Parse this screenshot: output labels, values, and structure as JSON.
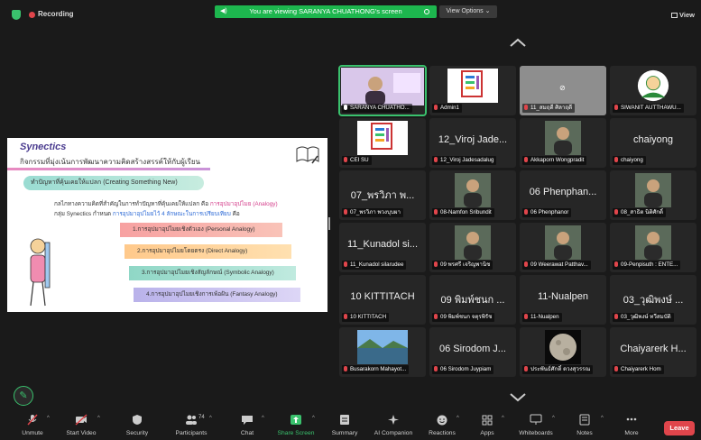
{
  "topbar": {
    "recording_label": "Recording",
    "banner_text": "You are viewing SARANYA CHUATHONG's screen",
    "view_options_label": "View Options",
    "view_label": "View"
  },
  "slide": {
    "title": "Synectics",
    "subtitle": "กิจกรรมที่มุ่งเน้นการพัฒนาความคิดสร้างสรรค์ให้กับผู้เรียน",
    "pill": "ทำปัญหาที่คุ้นเคยให้แปลก (Creating Something New)",
    "line1_a": "กลไกทางความคิดที่สำคัญในการทำปัญหาที่คุ้นเคยให้แปลก คือ",
    "line1_b": "การอุปมาอุปไมย (Analogy)",
    "line2_a": "กลุ่ม Synectics กำหนด",
    "line2_b": "การอุปมาอุปไมยไว้ 4 ลักษณะในการเปรียบเทียบ",
    "line2_c": "คือ",
    "ribbons": [
      "1.การอุปมาอุปไมยเชิงตัวเอง (Personal Analogy)",
      "2.การอุปมาอุปไมยโดยตรง (Direct Analogy)",
      "3.การอุปมาอุปไมยเชิงสัญลักษณ์ (Symbolic Analogy)",
      "4.การอุปมาอุปไมยเชิงการเพ้อฝัน (Fantasy Analogy)"
    ]
  },
  "gallery": {
    "tiles": [
      {
        "label": "SARANYA CHUATHO...",
        "big": "",
        "kind": "photo",
        "muted": false
      },
      {
        "label": "Admin1",
        "big": "",
        "kind": "logo",
        "muted": true
      },
      {
        "label": "11_สมฤดี ศิลาฤดี",
        "big": "",
        "kind": "gray",
        "muted": true
      },
      {
        "label": "SIWANIT AUTTHAWU...",
        "big": "",
        "kind": "cartoon",
        "muted": true
      },
      {
        "label": "CEI SU",
        "big": "",
        "kind": "logo",
        "muted": true
      },
      {
        "label": "12_Viroj Jadesadalug",
        "big": "12_Viroj Jade...",
        "kind": "name",
        "muted": true
      },
      {
        "label": "Akkaporn Wongpradit",
        "big": "",
        "kind": "photo",
        "muted": true
      },
      {
        "label": "chaiyong",
        "big": "chaiyong",
        "kind": "name",
        "muted": true
      },
      {
        "label": "07_พรวิภา พวงบุบผา",
        "big": "07_พรวิภา พ...",
        "kind": "name",
        "muted": true
      },
      {
        "label": "08-Namfon Sribundit",
        "big": "",
        "kind": "photo",
        "muted": true
      },
      {
        "label": "06 Phenphanor",
        "big": "06 Phenphan...",
        "kind": "name",
        "muted": true
      },
      {
        "label": "08_สาธิต นิติศักดิ์",
        "big": "",
        "kind": "photo",
        "muted": true
      },
      {
        "label": "11_Kunadol silarudee",
        "big": "11_Kunadol si...",
        "kind": "name",
        "muted": true
      },
      {
        "label": "09 พรศรี เจริญพานิช",
        "big": "",
        "kind": "photo",
        "muted": true
      },
      {
        "label": "09 Weerawat Patthav...",
        "big": "",
        "kind": "photo",
        "muted": true
      },
      {
        "label": "09-Penpisuth : ENTE...",
        "big": "",
        "kind": "photo",
        "muted": true
      },
      {
        "label": "10 KITTITACH",
        "big": "10 KITTITACH",
        "kind": "name",
        "muted": true
      },
      {
        "label": "09 พิมพ์ชนก จตุรพิรัช",
        "big": "09 พิมพ์ชนก ...",
        "kind": "name",
        "muted": true
      },
      {
        "label": "11-Nualpen",
        "big": "11-Nualpen",
        "kind": "name",
        "muted": true
      },
      {
        "label": "03_วุฒิพงษ์ ทวีสมบัติ",
        "big": "03_วุฒิพงษ์ ...",
        "kind": "name",
        "muted": true
      },
      {
        "label": "Busarakorn Mahayot...",
        "big": "",
        "kind": "landscape",
        "muted": true
      },
      {
        "label": "06 Sirodom Juypiam",
        "big": "06 Sirodom J...",
        "kind": "name",
        "muted": true
      },
      {
        "label": "ประพันธ์ศักดิ์ ดวงสุวรรณ",
        "big": "",
        "kind": "moon",
        "muted": true
      },
      {
        "label": "Chaiyarerk Hom",
        "big": "Chaiyarerk H...",
        "kind": "name",
        "muted": true
      }
    ]
  },
  "toolbar": {
    "unmute": "Unmute",
    "start_video": "Start Video",
    "security": "Security",
    "participants": "Participants",
    "participants_count": "74",
    "chat": "Chat",
    "share_screen": "Share Screen",
    "summary": "Summary",
    "ai_companion": "AI Companion",
    "reactions": "Reactions",
    "apps": "Apps",
    "whiteboards": "Whiteboards",
    "notes": "Notes",
    "more": "More",
    "leave": "Leave"
  },
  "colors": {
    "accent_green": "#3ac16d",
    "banner_green": "#1db64e",
    "leave_red": "#e0454b",
    "background": "#1a1a1a",
    "tile_bg": "#262626"
  }
}
